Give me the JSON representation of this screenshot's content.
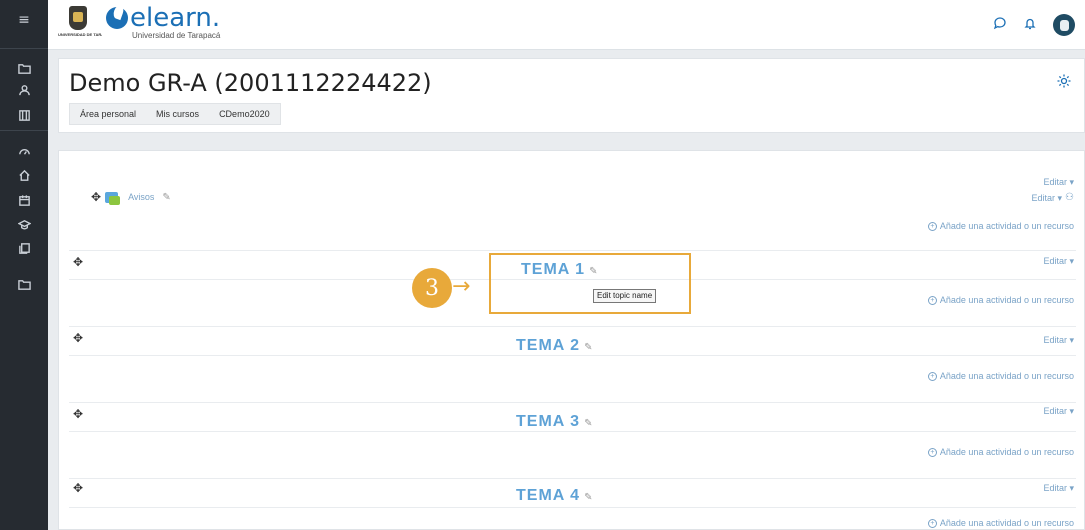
{
  "topbar": {
    "crest_caption": "UNIVERSIDAD DE TARAPACÁ",
    "logo_text": "elearn.",
    "logo_subtitle": "Universidad de Tarapacá",
    "icons": [
      "comment-icon",
      "bell-icon",
      "user-avatar"
    ]
  },
  "sidebar": {
    "menu_icon": "≡",
    "icons": [
      "folder-icon",
      "participants-icon",
      "grades-icon",
      "dashboard-icon",
      "home-icon",
      "calendar-icon",
      "graduation-cap-icon",
      "files-icon",
      "folder-icon"
    ]
  },
  "course": {
    "title": "Demo GR-A (2001112224422)",
    "breadcrumb": [
      "Área personal",
      "Mis cursos",
      "CDemo2020"
    ]
  },
  "general_section": {
    "editor_label_1": "Editar ▾",
    "editor_label_2": "Editar ▾",
    "activity_name": "Avisos",
    "add_activity": "Añade una actividad o un recurso"
  },
  "topics": [
    {
      "title": "TEMA 1",
      "editor": "Editar ▾",
      "add_activity": "Añade una actividad o un recurso"
    },
    {
      "title": "TEMA 2",
      "editor": "Editar ▾",
      "add_activity": "Añade una actividad o un recurso"
    },
    {
      "title": "TEMA 3",
      "editor": "Editar ▾",
      "add_activity": "Añade una actividad o un recurso"
    },
    {
      "title": "TEMA 4",
      "editor": "Editar ▾",
      "add_activity": "Añade una actividad o un recurso"
    }
  ],
  "tooltip": "Edit topic name",
  "annotation": {
    "step": "3",
    "arrow": "→"
  },
  "colors": {
    "accent": "#1b6fb5",
    "topic": "#5ea2d6",
    "annotation": "#e8a93a",
    "sidebar": "#262b31"
  }
}
